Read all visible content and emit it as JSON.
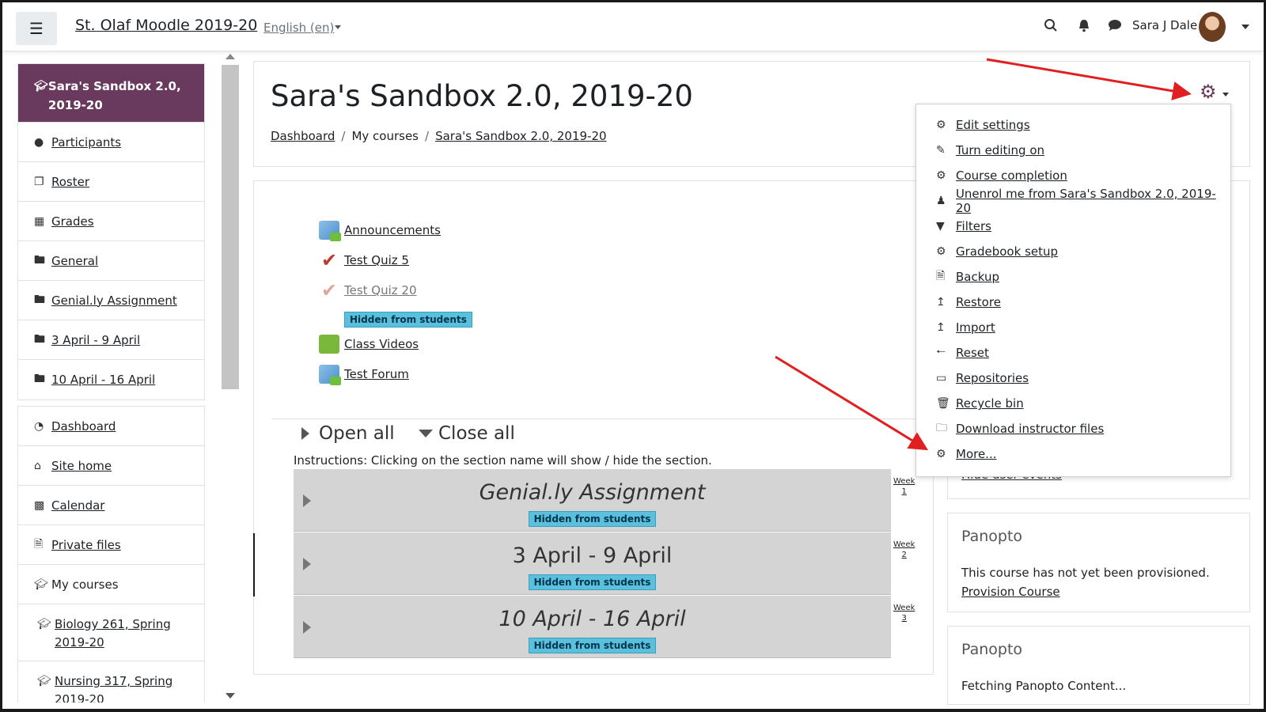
{
  "navbar": {
    "site_title": "St. Olaf Moodle 2019-20",
    "language": "English (en)",
    "user_name": "Sara J Dale"
  },
  "sidebar": {
    "course": "Sara's Sandbox 2.0, 2019-20",
    "course_items": [
      "Participants",
      "Roster",
      "Grades",
      "General",
      "Genial.ly Assignment",
      "3 April - 9 April",
      "10 April - 16 April"
    ],
    "site_items": [
      "Dashboard",
      "Site home",
      "Calendar",
      "Private files"
    ],
    "my_courses": "My courses",
    "courses": [
      "Biology 261, Spring 2019-20",
      "Nursing 317, Spring 2019-20"
    ]
  },
  "header": {
    "title": "Sara's Sandbox 2.0, 2019-20",
    "breadcrumb": [
      "Dashboard",
      "My courses",
      "Sara's Sandbox 2.0, 2019-20"
    ]
  },
  "activities": {
    "announcements": "Announcements",
    "quiz5": "Test Quiz 5",
    "quiz20": "Test Quiz 20",
    "hidden": "Hidden from students",
    "videos": "Class Videos",
    "forum": "Test Forum"
  },
  "controls": {
    "open_all": "Open all",
    "close_all": "Close all",
    "instructions": "Instructions: Clicking on the section name will show / hide the section."
  },
  "sections": [
    {
      "title": "Genial.ly Assignment",
      "badge": "Hidden from students",
      "week": "Week",
      "num": "1"
    },
    {
      "title": "3 April - 9 April",
      "badge": "Hidden from students",
      "week": "Week",
      "num": "2"
    },
    {
      "title": "10 April - 16 April",
      "badge": "Hidden from students",
      "week": "Week",
      "num": "3"
    }
  ],
  "menu": {
    "items": [
      "Edit settings",
      "Turn editing on",
      "Course completion",
      "Unenrol me from Sara's Sandbox 2.0, 2019-20",
      "Filters",
      "Gradebook setup",
      "Backup",
      "Restore",
      "Import",
      "Reset",
      "Repositories",
      "Recycle bin",
      "Download instructor files",
      "More..."
    ]
  },
  "blocks": {
    "partial_link": "Hide user events",
    "panopto1_title": "Panopto",
    "panopto1_text": "This course has not yet been provisioned.",
    "panopto1_link": "Provision Course",
    "panopto2_title": "Panopto",
    "panopto2_text": "Fetching Panopto Content..."
  },
  "colors": {
    "brand": "#693a5e",
    "badge": "#5bc0de",
    "annotation": "#e02020"
  }
}
